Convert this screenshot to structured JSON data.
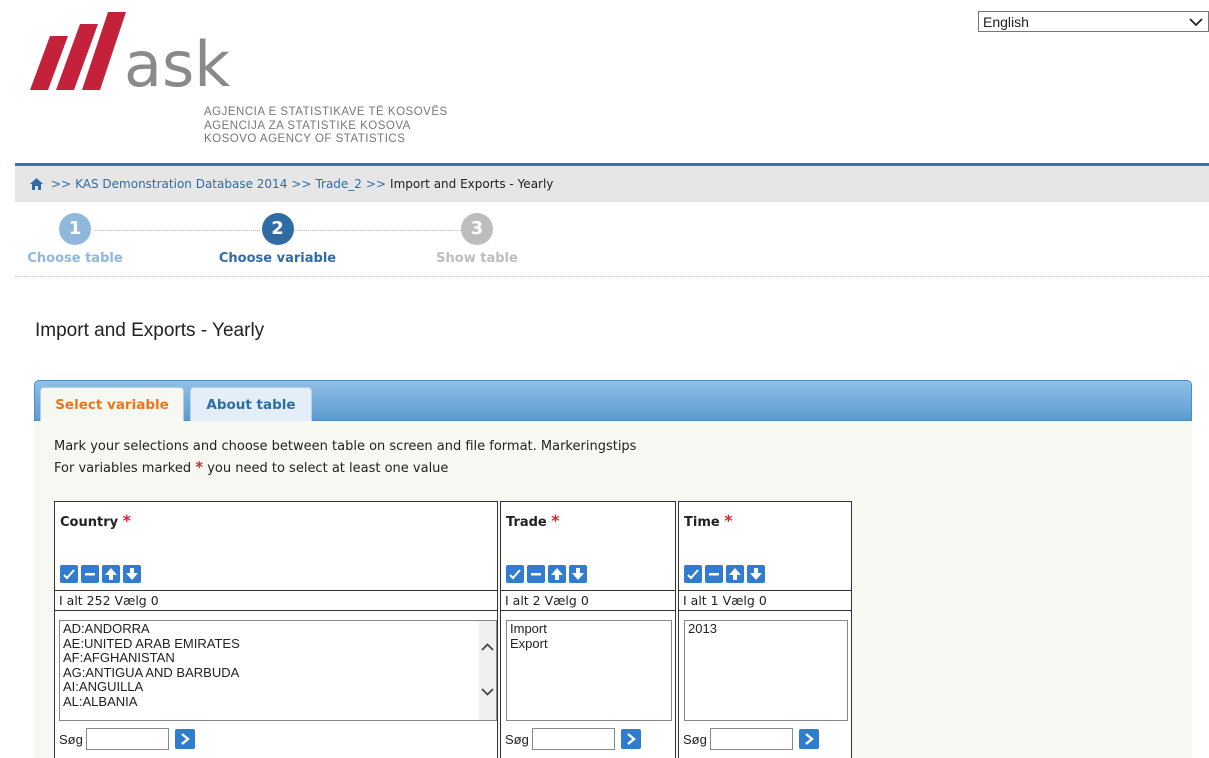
{
  "header": {
    "logo_text": "ask",
    "agency_names": [
      "AGJENCIA E STATISTIKAVE TË KOSOVËS",
      "AGENCIJA ZA STATISTIKE KOSOVA",
      "KOSOVO AGENCY OF STATISTICS"
    ],
    "language": "English",
    "brand_color": "#c4213b"
  },
  "breadcrumb": {
    "items": [
      "KAS Demonstration Database 2014",
      "Trade_2"
    ],
    "separator": ">>",
    "current": "Import and Exports - Yearly"
  },
  "steps": [
    {
      "number": "1",
      "label": "Choose table",
      "state": "done",
      "color": "#8fb8dc"
    },
    {
      "number": "2",
      "label": "Choose variable",
      "state": "active",
      "color": "#2f6ca5"
    },
    {
      "number": "3",
      "label": "Show table",
      "state": "pending",
      "color": "#bdbdbd"
    }
  ],
  "page_title": "Import and Exports - Yearly",
  "tabs": [
    {
      "label": "Select variable",
      "active": true
    },
    {
      "label": "About table",
      "active": false
    }
  ],
  "instructions": {
    "line1": "Mark your selections and choose between table on screen and file format. Markeringstips",
    "line2_pre": "For variables marked",
    "star": "*",
    "line2_post": "you need to select at least one value"
  },
  "variables": [
    {
      "name": "Country",
      "count_text": "I alt 252 Vælg",
      "selected": "0",
      "options": [
        "AD:ANDORRA",
        "AE:UNITED ARAB EMIRATES",
        "AF:AFGHANISTAN",
        "AG:ANTIGUA AND BARBUDA",
        "AI:ANGUILLA",
        "AL:ALBANIA"
      ],
      "search_label": "Søg"
    },
    {
      "name": "Trade",
      "count_text": "I alt 2 Vælg",
      "selected": "0",
      "options": [
        "Import",
        "Export"
      ],
      "search_label": "Søg"
    },
    {
      "name": "Time",
      "count_text": "I alt 1 Vælg",
      "selected": "0",
      "options": [
        "2013"
      ],
      "search_label": "Søg"
    }
  ],
  "icons": [
    "home-icon",
    "select-all-icon",
    "deselect-all-icon",
    "sort-ascending-icon",
    "sort-descending-icon",
    "search-go-icon",
    "chevron-down-icon",
    "scroll-up-icon",
    "scroll-down-icon"
  ]
}
